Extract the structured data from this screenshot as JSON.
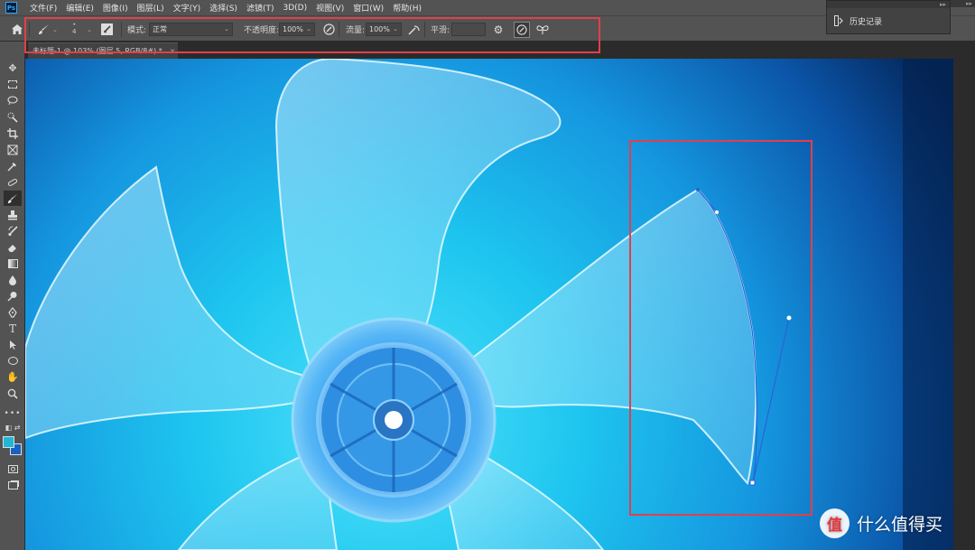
{
  "app": {
    "logo_text": "Ps"
  },
  "menu": [
    "文件(F)",
    "编辑(E)",
    "图像(I)",
    "图层(L)",
    "文字(Y)",
    "选择(S)",
    "滤镜(T)",
    "3D(D)",
    "视图(V)",
    "窗口(W)",
    "帮助(H)"
  ],
  "options": {
    "brush_size": "4",
    "mode_label": "模式:",
    "mode_value": "正常",
    "opacity_label": "不透明度:",
    "opacity_value": "100%",
    "flow_label": "流量:",
    "flow_value": "100%",
    "smoothing_label": "平滑:",
    "smoothing_value": ""
  },
  "document": {
    "tab_title": "未标题-1 @ 103% (图层 5, RGB/8#) *",
    "close": "×"
  },
  "history_panel": {
    "title": "历史记录",
    "collapse": "▸▸"
  },
  "watermark": {
    "text": "什么值得买",
    "badge_text": "值"
  },
  "colors": {
    "foreground": "#1fb6d8",
    "background": "#1761c4",
    "annotation": "#e0404a"
  },
  "tools": [
    "move-icon",
    "marquee-icon",
    "lasso-icon",
    "quick-select-icon",
    "crop-icon",
    "frame-icon",
    "eyedropper-icon",
    "healing-icon",
    "brush-icon",
    "stamp-icon",
    "history-brush-icon",
    "eraser-icon",
    "gradient-icon",
    "blur-icon",
    "dodge-icon",
    "pen-icon",
    "type-icon",
    "path-select-icon",
    "shape-icon",
    "hand-icon",
    "zoom-icon",
    "more-tools-icon"
  ]
}
